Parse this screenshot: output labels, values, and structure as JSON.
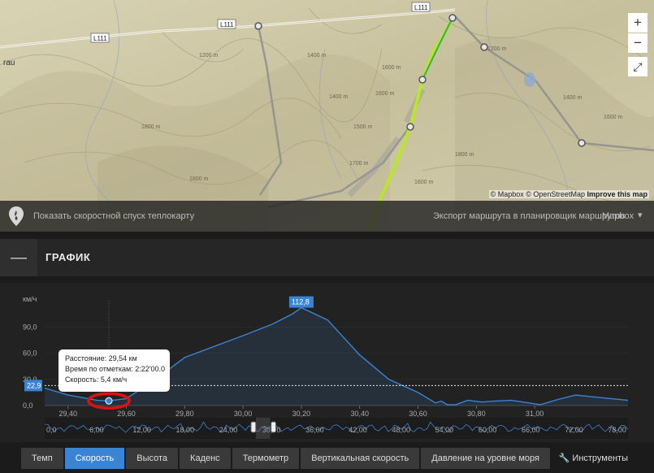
{
  "map": {
    "road_labels": [
      "L111",
      "L111",
      "L111"
    ],
    "contour_labels": [
      "1200 m",
      "1400 m",
      "1600 m",
      "1800 m",
      "1400 m",
      "1600 m",
      "1200 m",
      "1400 m",
      "1600 m",
      "1700 m",
      "1800 m",
      "1600 m",
      "1800 m",
      "1500 m"
    ],
    "place_label": "rau",
    "zoom_in": "+",
    "zoom_out": "−",
    "fullscreen_icon": "⤢",
    "attribution": {
      "mapbox": "© Mapbox",
      "osm": "© OpenStreetMap",
      "improve": "Improve this map"
    },
    "bar": {
      "heatmap_label": "Показать скоростной спуск теплокарту",
      "export_label": "Экспорт маршрута в планировщик маршрутов",
      "style_label": "Mapbox",
      "caret": "▾"
    }
  },
  "panel": {
    "title": "ГРАФИК",
    "collapse": "—"
  },
  "chart_data": {
    "type": "area",
    "ylabel": "км/ч",
    "yticks": [
      "0,0",
      "30,0",
      "60,0",
      "90,0"
    ],
    "ylim": [
      0,
      120
    ],
    "xlim": [
      29.32,
      31.32
    ],
    "xticks": [
      "29,40",
      "29,60",
      "29,80",
      "30,00",
      "30,20",
      "30,40",
      "30,60",
      "30,80",
      "31,00"
    ],
    "x": [
      29.32,
      29.4,
      29.5,
      29.54,
      29.6,
      29.7,
      29.8,
      30.0,
      30.1,
      30.17,
      30.2,
      30.29,
      30.4,
      30.5,
      30.6,
      30.66,
      30.68,
      30.7,
      30.73,
      30.77,
      30.82,
      30.86,
      30.92,
      30.96,
      31.02,
      31.08,
      31.14,
      31.2,
      31.26,
      31.32
    ],
    "y": [
      20,
      12,
      6,
      5.4,
      8,
      30,
      55,
      80,
      93,
      105,
      112,
      98,
      58,
      30,
      15,
      3,
      5,
      1,
      1,
      6,
      4,
      5,
      6,
      4,
      1,
      7,
      12,
      10,
      8,
      6
    ],
    "peak_label": "112,8",
    "ref_value": 22.9,
    "ref_label": "22,9",
    "marker": {
      "x": 29.54,
      "y": 5.4
    },
    "navigator_ticks": [
      "0,0",
      "6,00",
      "12,00",
      "18,00",
      "24,00",
      "30,00",
      "36,00",
      "42,00",
      "48,00",
      "54,00",
      "60,00",
      "66,00",
      "72,00",
      "78,00"
    ],
    "navigator_range": [
      29.32,
      31.32
    ]
  },
  "tooltip": {
    "distance": "Расстояние: 29,54 км",
    "time": "Время по отметкам: 2:22'00.0",
    "speed": "Скорость: 5,4 км/ч"
  },
  "tabs": [
    "Темп",
    "Скорость",
    "Высота",
    "Каденс",
    "Термометр",
    "Вертикальная скорость",
    "Давление на уровне моря"
  ],
  "active_tab": 1,
  "tools_label": "Инструменты",
  "colors": {
    "accent": "#3b83d3",
    "track": "#b8e62a",
    "annotation": "#e01010"
  }
}
